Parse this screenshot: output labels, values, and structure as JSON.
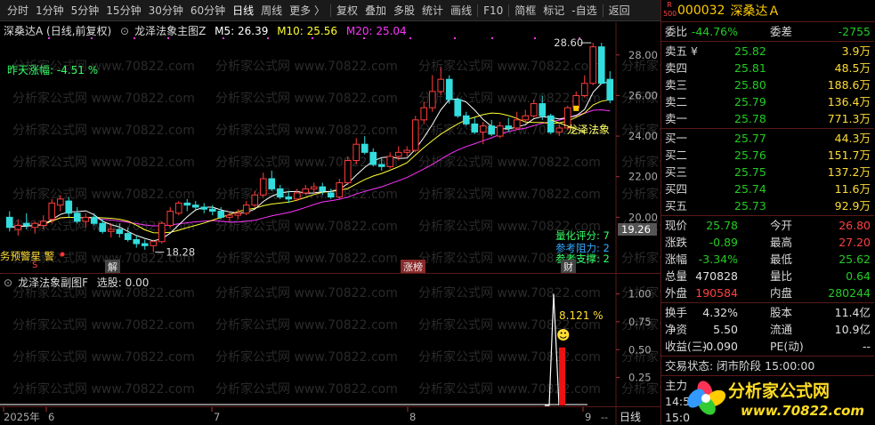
{
  "toolbar": {
    "items": [
      "分时",
      "1分钟",
      "5分钟",
      "15分钟",
      "30分钟",
      "60分钟",
      "日线",
      "周线",
      "更多 〉",
      "复权",
      "叠加",
      "多股",
      "统计",
      "画线",
      "F10",
      "简框",
      "标记",
      "-自选",
      "返回"
    ],
    "active": "日线"
  },
  "main_legend": {
    "stock": "深桑达A (日线,前复权)",
    "indicator": "龙泽法象主图Z",
    "m5": "M5: 26.39",
    "m10": "M10: 25.56",
    "m20": "M20: 25.04"
  },
  "main_annotations": {
    "yesterday_change": "昨天涨幅: -4.51 %",
    "high_label": "28.60",
    "low_label": "18.28",
    "trend_label": "龙泽法象",
    "quant_score": "量化评分: 7",
    "resistance": "参考阻力: 2",
    "support": "参考支撑: 2",
    "warning": "务预警星 警",
    "marker_s": "S",
    "badge_jie": "解",
    "badge_zhangbang": "涨榜",
    "badge_cai": "财",
    "cursor_price": "19.26",
    "y_ticks": [
      "28.00",
      "26.00",
      "24.00",
      "22.00",
      "20.00"
    ]
  },
  "sub_legend": {
    "indicator": "龙泽法象副图F",
    "pick": "选股: 0.00",
    "percent": "8.121 %",
    "y_ticks": [
      "1.00",
      "0.75",
      "0.50",
      "0.25"
    ]
  },
  "x_axis": {
    "labels": [
      "2025年",
      "6",
      "7",
      "8",
      "9"
    ],
    "period_button": "日线"
  },
  "quote": {
    "badge_top": "R",
    "badge_bottom": "500",
    "code": "000032",
    "name": "深桑达Ａ",
    "weibi_label": "委比",
    "weibi": "-44.76%",
    "weicha_label": "委差",
    "weicha": "-2755",
    "asks": [
      {
        "label": "卖五 ¥",
        "price": "25.82",
        "vol": "3.9万"
      },
      {
        "label": "卖四",
        "price": "25.81",
        "vol": "48.5万"
      },
      {
        "label": "卖三",
        "price": "25.80",
        "vol": "188.6万"
      },
      {
        "label": "卖二",
        "price": "25.79",
        "vol": "136.4万"
      },
      {
        "label": "卖一",
        "price": "25.78",
        "vol": "771.3万"
      }
    ],
    "bids": [
      {
        "label": "买一",
        "price": "25.77",
        "vol": "44.3万"
      },
      {
        "label": "买二",
        "price": "25.76",
        "vol": "151.7万"
      },
      {
        "label": "买三",
        "price": "25.75",
        "vol": "137.2万"
      },
      {
        "label": "买四",
        "price": "25.74",
        "vol": "11.6万"
      },
      {
        "label": "买五",
        "price": "25.73",
        "vol": "92.9万"
      }
    ],
    "stats1": [
      {
        "l1": "现价",
        "v1": "25.78",
        "c1": "green",
        "l2": "今开",
        "v2": "26.80",
        "c2": "red"
      },
      {
        "l1": "涨跌",
        "v1": "-0.89",
        "c1": "green",
        "l2": "最高",
        "v2": "27.20",
        "c2": "red"
      },
      {
        "l1": "涨幅",
        "v1": "-3.34%",
        "c1": "green",
        "l2": "最低",
        "v2": "25.62",
        "c2": "green"
      },
      {
        "l1": "总量",
        "v1": "470828",
        "c1": "white",
        "l2": "量比",
        "v2": "0.64",
        "c2": "green"
      },
      {
        "l1": "外盘",
        "v1": "190584",
        "c1": "red",
        "l2": "内盘",
        "v2": "280244",
        "c2": "green"
      }
    ],
    "stats2": [
      {
        "l1": "换手",
        "v1": "4.32%",
        "c1": "white",
        "l2": "股本",
        "v2": "11.4亿",
        "c2": "white"
      },
      {
        "l1": "净资",
        "v1": "5.50",
        "c1": "white",
        "l2": "流通",
        "v2": "10.9亿",
        "c2": "white"
      },
      {
        "l1": "收益(三)",
        "v1": "-0.090",
        "c1": "white",
        "l2": "PE(动)",
        "v2": "--",
        "c2": "white"
      }
    ],
    "status": "交易状态: 闭市阶段 15:00:00",
    "tail1": "主力",
    "tail2": "14:5",
    "tail3": "15:0"
  },
  "logo": {
    "title": "分析家公式网",
    "url": "www.70822.com"
  },
  "watermark": "分析家公式网 www.70822.com",
  "colors": {
    "up": "#ff3c3c",
    "down": "#33dddd",
    "m5": "#ffffff",
    "m10": "#ffff33",
    "m20": "#ff33ff",
    "bg": "#000000",
    "grid": "#5a1818"
  },
  "chart_data": {
    "type": "candlestick",
    "x": [
      "2025-05-27",
      "2025-05-28",
      "2025-05-29",
      "2025-05-30",
      "2025-06-03",
      "2025-06-04",
      "2025-06-05",
      "2025-06-06",
      "2025-06-09",
      "2025-06-10",
      "2025-06-11",
      "2025-06-12",
      "2025-06-13",
      "2025-06-16",
      "2025-06-17",
      "2025-06-18",
      "2025-06-19",
      "2025-06-20",
      "2025-06-23",
      "2025-06-24",
      "2025-06-25",
      "2025-06-26",
      "2025-06-27",
      "2025-06-30",
      "2025-07-01",
      "2025-07-02",
      "2025-07-03",
      "2025-07-04",
      "2025-07-07",
      "2025-07-08",
      "2025-07-09",
      "2025-07-10",
      "2025-07-11",
      "2025-07-14",
      "2025-07-15",
      "2025-07-16",
      "2025-07-17",
      "2025-07-18",
      "2025-07-21",
      "2025-07-22",
      "2025-07-23",
      "2025-07-24",
      "2025-07-25",
      "2025-07-28",
      "2025-07-29",
      "2025-07-30",
      "2025-07-31",
      "2025-08-01",
      "2025-08-04",
      "2025-08-05",
      "2025-08-06",
      "2025-08-07",
      "2025-08-08",
      "2025-08-11",
      "2025-08-12",
      "2025-08-13",
      "2025-08-14",
      "2025-08-15",
      "2025-08-18",
      "2025-08-19",
      "2025-08-20",
      "2025-08-21",
      "2025-08-22",
      "2025-08-25",
      "2025-08-26",
      "2025-08-27",
      "2025-08-28",
      "2025-08-29",
      "2025-09-01",
      "2025-09-02",
      "2025-09-03",
      "2025-09-04"
    ],
    "open": [
      20.0,
      19.4,
      19.7,
      19.5,
      19.6,
      19.9,
      20.6,
      20.8,
      20.2,
      19.8,
      20.0,
      19.7,
      19.3,
      19.4,
      19.2,
      18.9,
      18.7,
      18.6,
      18.8,
      19.6,
      20.2,
      20.7,
      20.6,
      20.5,
      20.4,
      20.3,
      20.0,
      20.1,
      20.2,
      20.6,
      21.1,
      21.9,
      21.4,
      21.0,
      20.9,
      21.2,
      21.4,
      21.5,
      21.2,
      21.0,
      21.7,
      22.8,
      23.6,
      23.2,
      22.6,
      22.5,
      23.0,
      23.2,
      23.3,
      24.8,
      25.4,
      26.2,
      26.8,
      25.8,
      25.0,
      24.6,
      24.2,
      24.5,
      24.0,
      24.5,
      24.4,
      24.8,
      25.0,
      25.6,
      25.0,
      24.2,
      24.4,
      25.4,
      26.0,
      26.6,
      28.4,
      26.8
    ],
    "high": [
      20.3,
      19.9,
      20.2,
      19.8,
      20.1,
      20.9,
      21.1,
      21.0,
      20.5,
      20.2,
      20.2,
      19.9,
      19.7,
      19.7,
      19.5,
      19.1,
      18.9,
      18.9,
      19.8,
      20.5,
      20.8,
      20.9,
      20.8,
      20.7,
      20.6,
      20.5,
      20.3,
      20.4,
      20.8,
      21.3,
      22.2,
      22.3,
      21.6,
      21.3,
      21.4,
      21.6,
      21.7,
      21.7,
      21.4,
      21.9,
      23.0,
      23.9,
      24.0,
      23.4,
      22.9,
      23.2,
      23.5,
      23.5,
      25.0,
      25.7,
      27.0,
      27.4,
      27.0,
      25.9,
      25.2,
      24.9,
      24.7,
      24.8,
      24.7,
      24.9,
      25.2,
      25.3,
      25.8,
      26.0,
      25.1,
      24.6,
      25.5,
      26.2,
      27.0,
      28.6,
      28.6,
      27.2
    ],
    "low": [
      19.3,
      19.1,
      19.4,
      19.2,
      19.4,
      19.7,
      20.3,
      20.0,
      19.7,
      19.5,
      19.6,
      19.2,
      19.0,
      19.0,
      18.8,
      18.5,
      18.4,
      18.28,
      18.7,
      19.5,
      20.1,
      20.3,
      20.3,
      20.2,
      20.1,
      19.9,
      19.8,
      19.9,
      20.1,
      20.5,
      21.0,
      21.3,
      20.9,
      20.7,
      20.8,
      21.1,
      21.2,
      21.1,
      20.9,
      20.9,
      21.6,
      22.6,
      23.1,
      22.5,
      22.3,
      22.4,
      22.8,
      23.0,
      23.2,
      24.6,
      25.2,
      26.0,
      25.6,
      24.9,
      24.5,
      24.1,
      23.6,
      24.0,
      23.9,
      24.2,
      24.3,
      24.6,
      24.9,
      24.8,
      24.1,
      24.0,
      24.3,
      25.3,
      25.9,
      26.5,
      26.6,
      25.62
    ],
    "close": [
      19.5,
      19.6,
      19.6,
      19.7,
      19.8,
      20.7,
      20.9,
      20.2,
      19.8,
      20.0,
      19.7,
      19.3,
      19.4,
      19.2,
      18.9,
      18.7,
      18.6,
      18.8,
      19.7,
      20.3,
      20.7,
      20.6,
      20.5,
      20.4,
      20.3,
      20.0,
      20.1,
      20.2,
      20.6,
      21.1,
      21.9,
      21.4,
      21.0,
      20.9,
      21.2,
      21.4,
      21.5,
      21.3,
      21.0,
      21.7,
      22.8,
      23.6,
      23.2,
      22.6,
      22.5,
      23.0,
      23.2,
      23.3,
      24.8,
      25.4,
      26.2,
      26.8,
      25.8,
      25.0,
      24.6,
      24.2,
      24.5,
      24.1,
      24.5,
      24.4,
      24.8,
      25.0,
      25.6,
      25.0,
      24.2,
      24.4,
      25.4,
      26.0,
      26.6,
      28.4,
      26.6,
      25.78
    ],
    "ylim": [
      18.0,
      29.0
    ],
    "sub": {
      "type": "line",
      "values_last": [
        0.0,
        0.0,
        1.0,
        0.0
      ],
      "bar_value": 0.52,
      "ylim": [
        0,
        1.1
      ]
    }
  }
}
